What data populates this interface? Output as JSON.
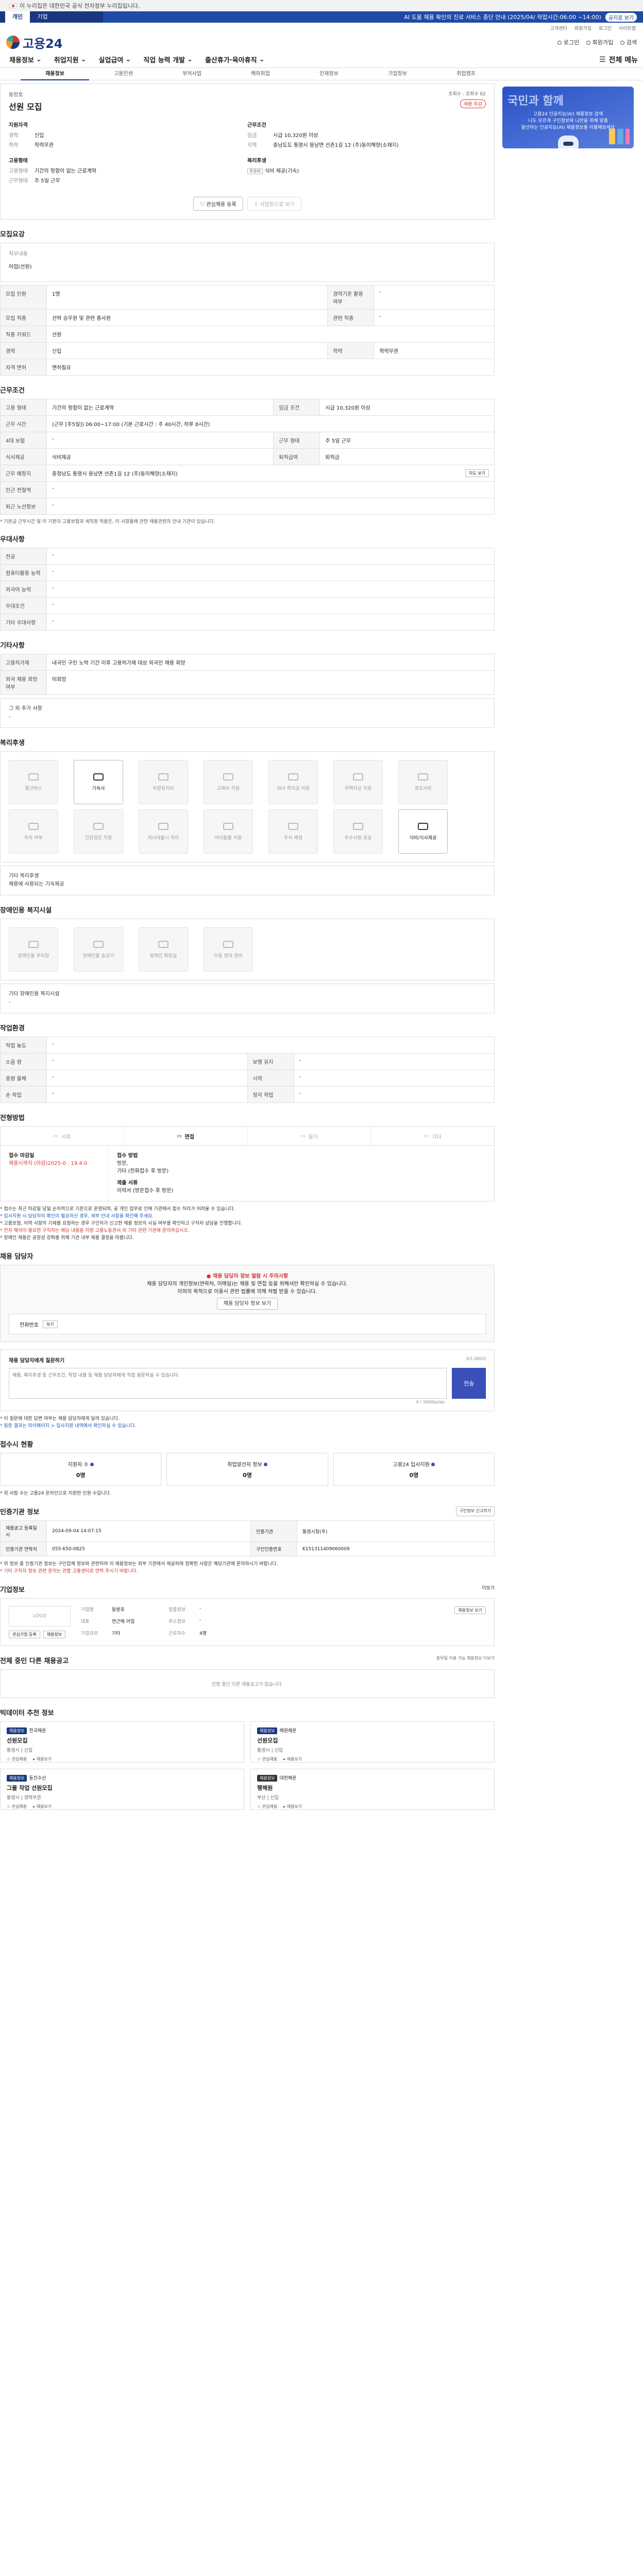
{
  "gov_banner": "이 누리집은 대한민국 공식 전자정부 누리집입니다.",
  "top_tabs": [
    "개인",
    "기업"
  ],
  "notice": {
    "text": "AI 도움 채용 확인의 진로 서비스 중단 안내 (2025/04/ 작업시간:06:00 ~14:00)",
    "pill": "공지로 보기"
  },
  "util_links": [
    "고객센터",
    "회원가입",
    "로그인",
    "사이트맵"
  ],
  "logo_text": "고용24",
  "logo_right": [
    "로그인",
    "회원가입",
    "검색"
  ],
  "gnb": [
    "채용정보",
    "취업지원",
    "실업급여",
    "직업 능력 개발",
    "출산휴가·육아휴직"
  ],
  "gnb_all": "전체 메뉴",
  "subnav": [
    "채용정보",
    "고용인센",
    "부처사업",
    "해외취업",
    "인재정보",
    "기업정보",
    "취업캠프"
  ],
  "side_banner": {
    "title": "국민과 함께",
    "line1": "고용24 인공지능(AI) 채용정보 검색",
    "line2": "나도 모르게 구인정보와 나만을 위해 맞춤",
    "line3": "알선하는 인공지능(AI) 채용정보를 이용해보세요"
  },
  "head": {
    "company": "동방호",
    "title": "선원 모집",
    "views": "조회수 : 조회수 82",
    "badge": "채용 마감",
    "left_h": "지원자격",
    "right_h": "근무조건",
    "left": [
      {
        "k": "경력",
        "v": "신입"
      },
      {
        "k": "학력",
        "v": "학력무관"
      }
    ],
    "right": [
      {
        "k": "임금",
        "v": "시급 10,320원 이상"
      },
      {
        "k": "지역",
        "v": "충남도도 통영시 용남면 선촌1길 12 (주)동이해양(소재지)"
      }
    ],
    "left2_h": "고용형태",
    "left2": [
      {
        "k": "고용형태",
        "v": "기간의 정함이 없는 근로계약"
      },
      {
        "k": "근무형태",
        "v": "주 5일 근무"
      }
    ],
    "right2_h": "복리후생",
    "right2": [
      {
        "k": "",
        "tag": "주유비",
        "v": "식비 제공(기숙)"
      }
    ],
    "btn_save": "관심채용 등록",
    "btn_apply": "사업장으로 보기"
  },
  "sections": {
    "eligibility": "모집요강",
    "work": "근무조건",
    "pref": "우대사항",
    "other": "기타사항",
    "welfare": "복리후생",
    "disabled_welfare": "장애인용 복지시설",
    "environment": "작업환경",
    "method": "전형방법",
    "contact": "채용 담당자",
    "status": "접수시 현황",
    "info": "인증기관 정보",
    "agency": "기업정보",
    "other_jobs": "전체 중인 다른 채용공고",
    "recommend": "빅데이터 추천 정보"
  },
  "duty": {
    "h": "직무내용",
    "v": "어업(선원)"
  },
  "recruit_rows": [
    [
      "모집 인원",
      "1명",
      "경력기준 활용 여부",
      "-"
    ],
    [
      "모집 직종",
      "선박 승무원 및 관련 종사원",
      "관련 직종",
      "-"
    ],
    [
      "직종 키워드",
      "선원",
      "",
      ""
    ],
    [
      "경력",
      "신입",
      "학력",
      "학력무관"
    ],
    [
      "자격 면허",
      "면허필요",
      "",
      ""
    ]
  ],
  "work_rows": [
    [
      "고용 형태",
      "기간의 정함이 없는 근로계약",
      "임금 조건",
      "시급 10,320원 이상"
    ],
    [
      "근무 시간",
      "(근무 [주5일]) 06:00~17:00 (기본 근로시간 : 주 40시간, 하루 8시간)",
      "",
      ""
    ],
    [
      "4대 보험",
      "-",
      "근무 형태",
      "주 5일 근무"
    ],
    [
      "식사제공",
      "식비제공",
      "퇴직급여",
      "퇴직금"
    ],
    [
      "근무 예정지",
      "충청남도 통영시 용남면 선촌1길 12 (주)동이해양(소재지)",
      "",
      ""
    ],
    [
      "인근 전철역",
      "-",
      "",
      ""
    ],
    [
      "퇴근 노선정보",
      "-",
      "",
      ""
    ]
  ],
  "work_map_btn": "지도 보기",
  "work_note": "* 기본급 근무시간 및 이 기본이 고용보험과 세칙정 적용은, 이 사항들에 관한 채용관련자 안내 기관이 있습니다.",
  "pref_rows": [
    [
      "전공",
      "-"
    ],
    [
      "컴퓨터활용 능력",
      "-"
    ],
    [
      "외국어 능력",
      "-"
    ],
    [
      "우대조건",
      "-"
    ],
    [
      "기타 우대사항",
      "-"
    ]
  ],
  "other_rows": [
    [
      "고용허가제",
      "내국인 구인 노력 기간 이후 고용허가제 대상 외국인 채용 희망"
    ],
    [
      "외국 채용 희망 여부",
      "미희망"
    ]
  ],
  "other_box": {
    "h": "그 외 추가 사항",
    "v": "-"
  },
  "welfare_items": [
    {
      "label": "통근버스",
      "on": false
    },
    {
      "label": "기숙사",
      "on": true
    },
    {
      "label": "차량유지비",
      "on": false
    },
    {
      "label": "교육비 지원",
      "on": false
    },
    {
      "label": "자녀 학자금 지원",
      "on": false
    },
    {
      "label": "주택자금 지원",
      "on": false
    },
    {
      "label": "경조사비",
      "on": false
    },
    {
      "label": "주차 여부",
      "on": false
    },
    {
      "label": "건강검진 지원",
      "on": false
    },
    {
      "label": "자녀대출시 저리",
      "on": false
    },
    {
      "label": "아이돌봄 지원",
      "on": false
    },
    {
      "label": "주식 배정",
      "on": false
    },
    {
      "label": "우수사원 포상",
      "on": false
    },
    {
      "label": "식비/식사제공",
      "on": true
    }
  ],
  "welfare_extra": {
    "h": "기타 복리후생",
    "v": "채용에 사용되는 기숙제공"
  },
  "disabled_items": [
    "장애인용 주차장",
    "장애인용 승강기",
    "장애인 화장실",
    "이동 편의 장비"
  ],
  "disabled_extra": {
    "h": "기타 장애인용 복지시설",
    "v": "-"
  },
  "env_rows": [
    [
      "작업 농도",
      "-",
      "",
      ""
    ],
    [
      "소음 량",
      "-",
      "보행 유지",
      "-"
    ],
    [
      "중량 물체",
      "-",
      "시력",
      "-"
    ],
    [
      "손 작업",
      "-",
      "청각 작업",
      "-"
    ]
  ],
  "method_tabs": [
    "서류",
    "면접",
    "필기",
    "기타"
  ],
  "method_on": 1,
  "method_left": {
    "h": "접수 마감일",
    "v": "채용시까지 (마감)2025-0 . 19.4.0"
  },
  "method_right": {
    "h": "접수 방법",
    "lines": [
      "방문,",
      "기타 (전화접수 후 방문)"
    ],
    "h2": "제출 서류",
    "lines2": [
      "이력서 (방문접수 후 방문)"
    ]
  },
  "method_bullets": [
    "* 접수는 최근 마감일 당일 순차적으로 기준으로 운영되며, 공 개인 업무로 인해 기관에서 접수 처리가 어려울 수 있습니다.",
    "* 입사지원 시 담당자의 확인이 필요하신 경우, 세부 안내 사항을 확인해 주세요.",
    "* 고용보험, 이력 사항의 기재를 요청하는 경우 구인자가 신고한 채용 정보의 사실 여부를 확인하고 구직자 상담을 진행합니다.",
    "* 전자 해석이 필요한 구직자는 해당 내용을 지방 고용노동관서 외 기타 관련 기관에 문의하십시오.",
    "* 장애인 채용은 공정성 강화를 위해 기관 내부 채용 결정을 따릅니다."
  ],
  "contact": {
    "warn_title": "채용 담당자 정보 열람 시 주의사항",
    "warn1": "채용 담당자의 개인정보(연락처, 이메일)는 채용 및 면접 등을 위해서만 확인하실 수 있습니다.",
    "warn2": "이외의 목적으로 이용시 관련 법률에 의해 처벌 받을 수 있습니다.",
    "btn": "채용 담당자 정보 보기",
    "label": "전화번호",
    "pill": "보기"
  },
  "qa": {
    "title": "채용 담당자에게 질문하기",
    "right": "0/1,000자 ",
    "placeholder": "채용, 복리후생 등 근무조건, 작업 내용 등 채용 담당자에게 직접 질문하실 수 있습니다.",
    "count": "0 / 1000bytes",
    "send": "전송",
    "notes": [
      "* 이 질문에 대한 답변 여부는 채용 담당자에게 달려 있습니다.",
      "* 질문 결과는 마이페이지 > 입사지원 내역에서 확인하실 수 있습니다."
    ]
  },
  "stats": [
    {
      "label": "지원자 수",
      "n": "0명"
    },
    {
      "label": "취업알선자 정보",
      "n": "0명"
    },
    {
      "label": "고용24 입사지원",
      "n": "0명"
    }
  ],
  "stats_note": "* 위 사람 수는 고용24 온라인으로 지원한 인원 수입니다.",
  "info_rows": [
    [
      "채용공고 등록일시",
      "2024-09-04 14:07:15",
      "인증기관",
      "통영시청(주)"
    ],
    [
      "인증기관 연락처",
      "055-650-0825",
      "구인인증번호",
      "K151311409060009"
    ]
  ],
  "info_btn": "구인정보 신고하기",
  "info_notes": [
    "* 위 정보 중 인증기관 정보는 구인업체 정보와 관련하여 이 채용정보는 외부 기관에서 제공하며 정확한 사항은 해당기관에 문의하시기 바랍니다.",
    "* 기타 구직자 정보 관련 문의는 관할 고용센터로 연락 주시기 바랍니다."
  ],
  "agency": {
    "logo": "LOGO",
    "rows": [
      [
        "기업명",
        "동방호",
        "업종정보",
        "-"
      ],
      [
        "대표",
        "연근해 어업",
        "주소정보",
        "-"
      ],
      [
        "기업규모",
        "기타",
        "근로자수",
        "4명"
      ]
    ],
    "btn_left": "관심기업 등록",
    "btn_right": "채용정보",
    "more": "더보기",
    "agency_btn": "채용정보 보기"
  },
  "other_jobs_note": "진행 중인 다른 채용공고가 없습니다.",
  "other_jobs_right": "총무팀 이용 가능 채용정보 더보기",
  "recommend": [
    {
      "tag": "채용정보",
      "org": "한국해운",
      "title": "선원모집",
      "meta": "통영시 | 신입",
      "b1": "관심채용",
      "b2": "채용보기"
    },
    {
      "tag": "채용정보",
      "org": "해원해운",
      "title": "선원모집",
      "meta": "통영시 | 신입",
      "b1": "관심채용",
      "b2": "채용보기"
    },
    {
      "tag": "채용정보",
      "org": "동진수산",
      "title": "그물 작업 선원모집",
      "meta": "통영시 | 경력무관",
      "b1": "관심채용",
      "b2": "채용보기"
    },
    {
      "tag": "채용정보",
      "org": "대한해운",
      "title": "행해원",
      "meta": "부산 | 신입",
      "b1": "관심채용",
      "b2": "채용보기"
    }
  ]
}
